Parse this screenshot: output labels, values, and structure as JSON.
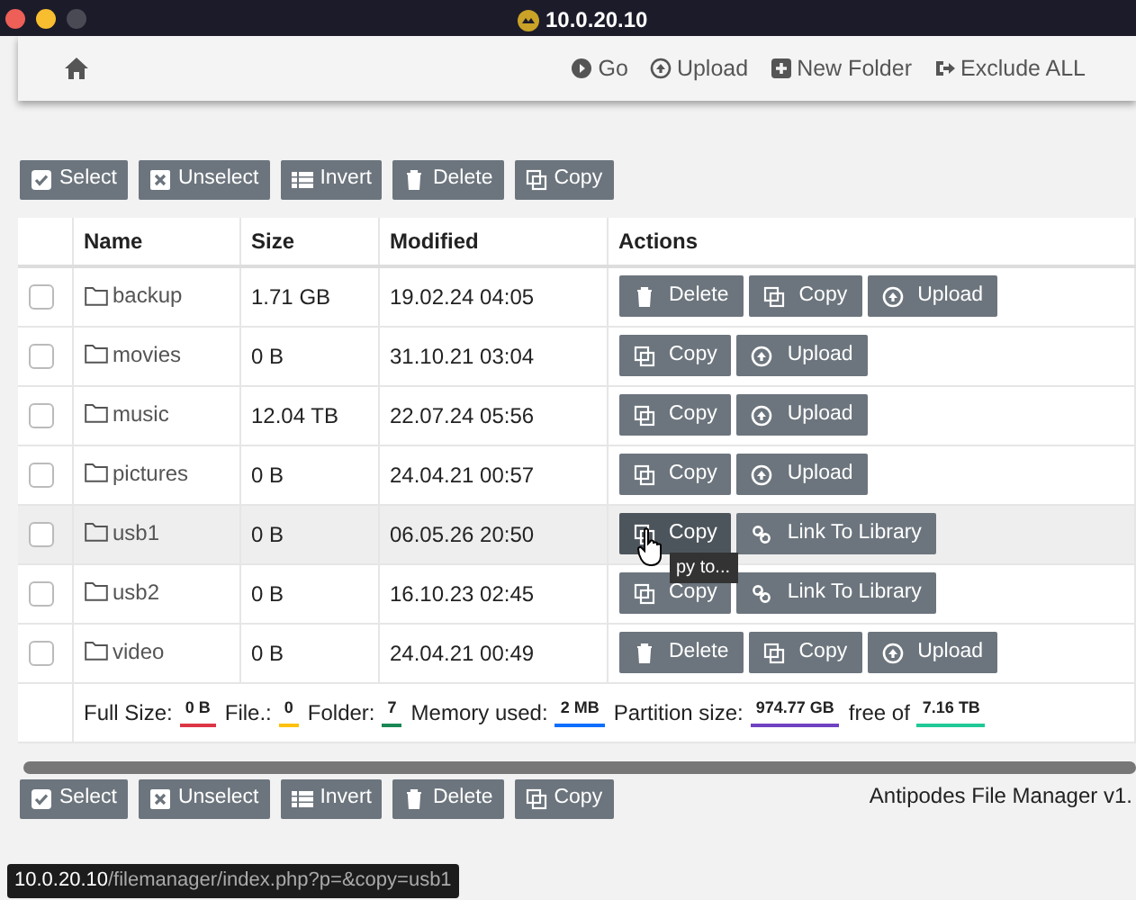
{
  "window": {
    "title": "10.0.20.10"
  },
  "nav": [
    {
      "kind": "go",
      "label": "Go"
    },
    {
      "kind": "upload",
      "label": "Upload"
    },
    {
      "kind": "newfolder",
      "label": "New Folder"
    },
    {
      "kind": "exclude",
      "label": "Exclude ALL"
    }
  ],
  "toolbar": [
    {
      "kind": "select",
      "label": "Select"
    },
    {
      "kind": "unselect",
      "label": "Unselect"
    },
    {
      "kind": "invert",
      "label": "Invert"
    },
    {
      "kind": "delete",
      "label": "Delete"
    },
    {
      "kind": "copy",
      "label": "Copy"
    }
  ],
  "table": {
    "columns": [
      "Name",
      "Size",
      "Modified",
      "Actions"
    ],
    "rows": [
      {
        "name": "backup",
        "size": "1.71 GB",
        "modified": "19.02.24 04:05",
        "checked": false,
        "highlighted": false,
        "actions": [
          {
            "kind": "delete",
            "label": "Delete"
          },
          {
            "kind": "copy",
            "label": "Copy"
          },
          {
            "kind": "upload",
            "label": "Upload"
          }
        ]
      },
      {
        "name": "movies",
        "size": "0 B",
        "modified": "31.10.21 03:04",
        "checked": false,
        "highlighted": false,
        "actions": [
          {
            "kind": "copy",
            "label": "Copy"
          },
          {
            "kind": "upload",
            "label": "Upload"
          }
        ]
      },
      {
        "name": "music",
        "size": "12.04 TB",
        "modified": "22.07.24 05:56",
        "checked": false,
        "highlighted": false,
        "actions": [
          {
            "kind": "copy",
            "label": "Copy"
          },
          {
            "kind": "upload",
            "label": "Upload"
          }
        ]
      },
      {
        "name": "pictures",
        "size": "0 B",
        "modified": "24.04.21 00:57",
        "checked": false,
        "highlighted": false,
        "actions": [
          {
            "kind": "copy",
            "label": "Copy"
          },
          {
            "kind": "upload",
            "label": "Upload"
          }
        ]
      },
      {
        "name": "usb1",
        "size": "0 B",
        "modified": "06.05.26 20:50",
        "checked": false,
        "highlighted": true,
        "actions": [
          {
            "kind": "copy",
            "label": "Copy",
            "tooltip": "py to..."
          },
          {
            "kind": "link",
            "label": "Link To Library"
          }
        ]
      },
      {
        "name": "usb2",
        "size": "0 B",
        "modified": "16.10.23 02:45",
        "checked": false,
        "highlighted": false,
        "actions": [
          {
            "kind": "copy",
            "label": "Copy"
          },
          {
            "kind": "link",
            "label": "Link To Library"
          }
        ]
      },
      {
        "name": "video",
        "size": "0 B",
        "modified": "24.04.21 00:49",
        "checked": false,
        "highlighted": false,
        "actions": [
          {
            "kind": "delete",
            "label": "Delete"
          },
          {
            "kind": "copy",
            "label": "Copy"
          },
          {
            "kind": "upload",
            "label": "Upload"
          }
        ]
      }
    ]
  },
  "summary": [
    {
      "label": "Full Size:",
      "value": "0 B",
      "color": "#dc3545"
    },
    {
      "label": "File.:",
      "value": "0",
      "color": "#ffc107"
    },
    {
      "label": "Folder:",
      "value": "7",
      "color": "#198754"
    },
    {
      "label": "Memory used:",
      "value": "2 MB",
      "color": "#0d6efd"
    },
    {
      "label": "Partition size:",
      "value": "974.77 GB",
      "color": "#6f42c1"
    },
    {
      "label": "free of",
      "value": "7.16 TB",
      "color": "#20c997"
    }
  ],
  "bottom_toolbar": [
    {
      "kind": "select",
      "label": "Select"
    },
    {
      "kind": "unselect",
      "label": "Unselect"
    },
    {
      "kind": "invert",
      "label": "Invert"
    },
    {
      "kind": "delete",
      "label": "Delete"
    },
    {
      "kind": "copy",
      "label": "Copy"
    }
  ],
  "footer": "Antipodes File Manager v1.",
  "status_url": {
    "host": "10.0.20.10",
    "path": "/filemanager/index.php?p=&copy=usb1"
  }
}
